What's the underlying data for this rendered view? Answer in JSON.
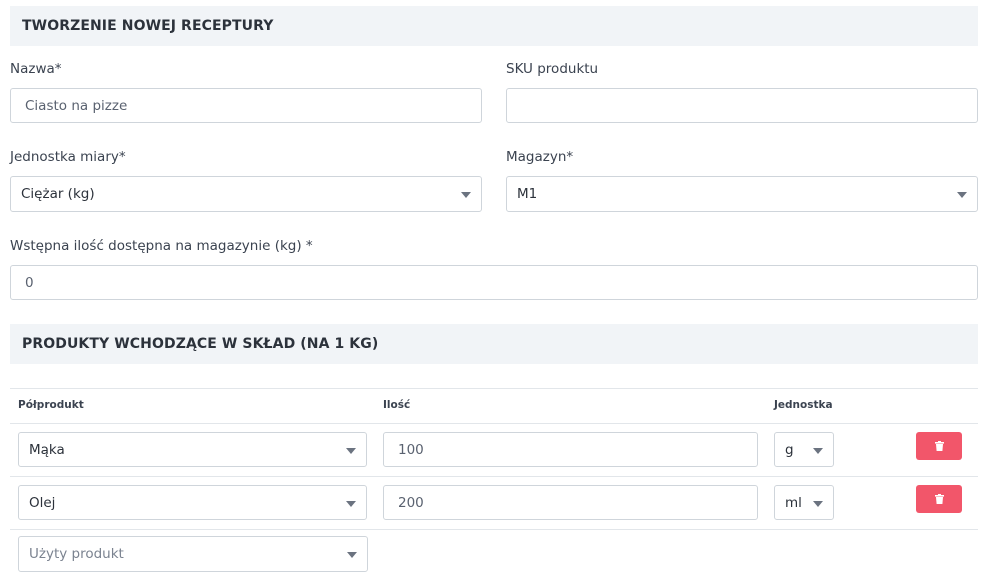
{
  "form": {
    "title": "TWORZENIE NOWEJ RECEPTURY",
    "name_label": "Nazwa*",
    "name_value": "Ciasto na pizze",
    "sku_label": "SKU produktu",
    "sku_value": "",
    "unit_label": "Jednostka miary*",
    "unit_value": "Ciężar (kg)",
    "warehouse_label": "Magazyn*",
    "warehouse_value": "M1",
    "initial_qty_label": "Wstępna ilość dostępna na magazynie (kg) *",
    "initial_qty_value": "0"
  },
  "ingredients": {
    "title": "PRODUKTY WCHODZĄCE W SKŁAD (NA 1 KG)",
    "columns": [
      "Półprodukt",
      "Ilość",
      "Jednostka"
    ],
    "rows": [
      {
        "product": "Mąka",
        "quantity": "100",
        "unit": "g"
      },
      {
        "product": "Olej",
        "quantity": "200",
        "unit": "ml"
      }
    ],
    "new_row_placeholder": "Użyty produkt"
  },
  "colors": {
    "header_bg": "#f1f4f7",
    "delete_button": "#f2566a",
    "border": "#cfd5db"
  },
  "icons": {
    "delete": "trash-icon",
    "dropdown": "chevron-down-icon"
  }
}
